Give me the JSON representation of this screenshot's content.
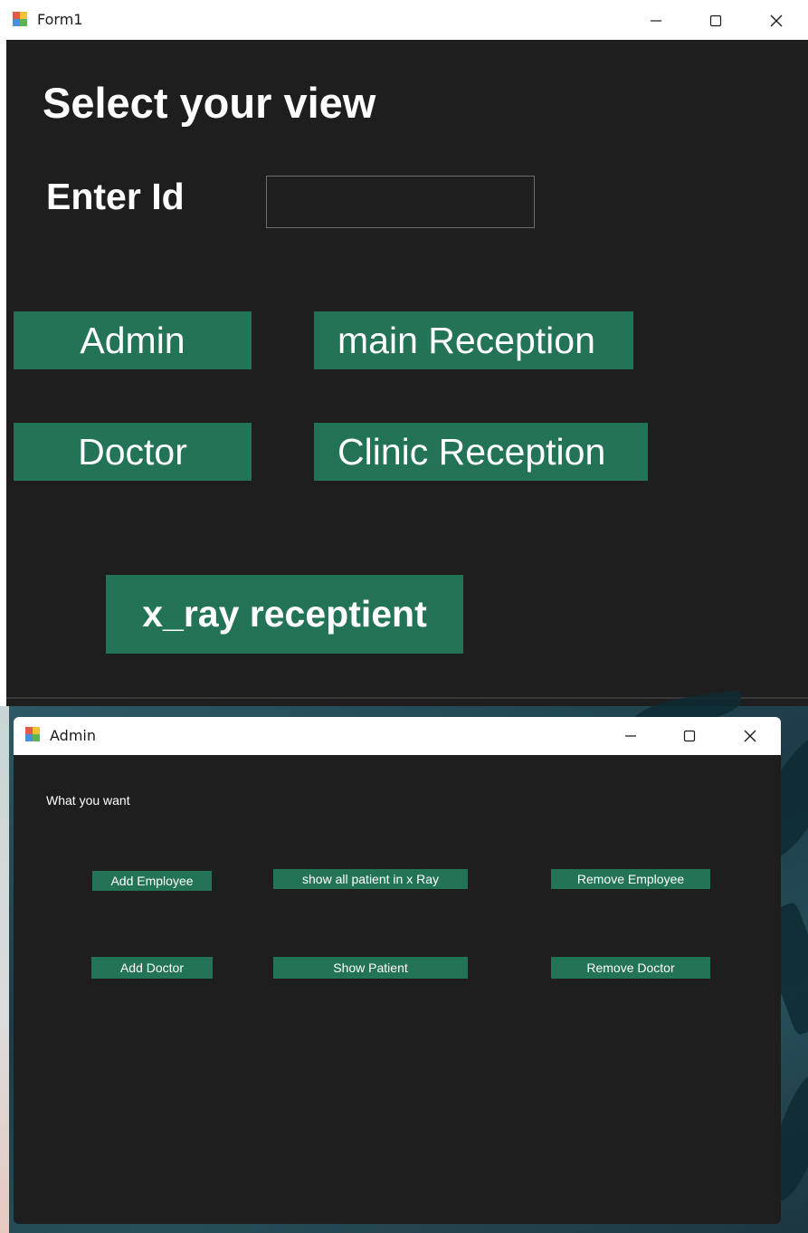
{
  "form1": {
    "title": "Form1",
    "heading": "Select your view",
    "id_label": "Enter Id",
    "id_input": {
      "value": "",
      "placeholder": ""
    },
    "buttons": {
      "admin": "Admin",
      "main_reception": "main Reception",
      "doctor": "Doctor",
      "clinic_reception": "Clinic Reception",
      "xray_receptient": "x_ray receptient"
    }
  },
  "admin_window": {
    "title": "Admin",
    "prompt": "What you want",
    "buttons": {
      "add_employee": "Add Employee",
      "show_all_patient_xray": "show all patient in x  Ray",
      "remove_employee": "Remove Employee",
      "add_doctor": "Add Doctor",
      "show_patient": "Show Patient",
      "remove_doctor": "Remove Doctor"
    }
  },
  "icons": {
    "app": "winforms-app-icon",
    "minimize": "minimize-icon",
    "maximize": "maximize-icon",
    "close": "close-icon"
  },
  "colors": {
    "window_background": "#1e1e1e",
    "button_green": "#237356",
    "text": "#ffffff",
    "titlebar": "#ffffff"
  }
}
